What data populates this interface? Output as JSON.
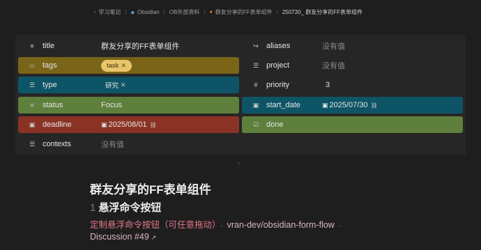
{
  "breadcrumb": [
    {
      "label": "学习笔记",
      "icon": "folder-icon"
    },
    {
      "label": "Obsidian",
      "icon": "obsidian-icon"
    },
    {
      "label": "OB外部资料",
      "icon": "folder-icon"
    },
    {
      "label": "群友分享的FF表单组件",
      "icon": "fire-icon"
    },
    {
      "label": "250730_ 群友分享的FF表单组件",
      "icon": ""
    }
  ],
  "properties": {
    "title": {
      "key": "title",
      "value": "群友分享的FF表单组件",
      "icon": "text-icon"
    },
    "aliases": {
      "key": "aliases",
      "value": "没有值",
      "icon": "forward-arrow-icon"
    },
    "tags": {
      "key": "tags",
      "tag": "task",
      "icon": "tag-icon",
      "color": "#7a6418"
    },
    "project": {
      "key": "project",
      "value": "没有值",
      "icon": "list-icon"
    },
    "type": {
      "key": "type",
      "tag": "研究",
      "icon": "list-icon",
      "color": "#0d5566"
    },
    "priority": {
      "key": "priority",
      "value": "3",
      "icon": "number-icon"
    },
    "status": {
      "key": "status",
      "value": "Focus",
      "icon": "text-icon",
      "color": "#5f7f3c"
    },
    "start_date": {
      "key": "start_date",
      "value": "2025/07/30",
      "icon": "calendar-icon",
      "color": "#0d5566"
    },
    "deadline": {
      "key": "deadline",
      "value": "2025/08/01",
      "icon": "calendar-icon",
      "color": "#8a3324"
    },
    "done": {
      "key": "done",
      "icon": "checkbox-icon",
      "color": "#5f7f3c"
    },
    "contexts": {
      "key": "contexts",
      "value": "没有值",
      "icon": "list-icon"
    }
  },
  "content": {
    "heading1": "群友分享的FF表单组件",
    "heading2_num": "1",
    "heading2": "悬浮命令按钮",
    "pink_text": "定制悬浮命令按钮（可任意拖动）",
    "link1": "vran-dev/obsidian-form-flow",
    "link2": "Discussion #49"
  }
}
